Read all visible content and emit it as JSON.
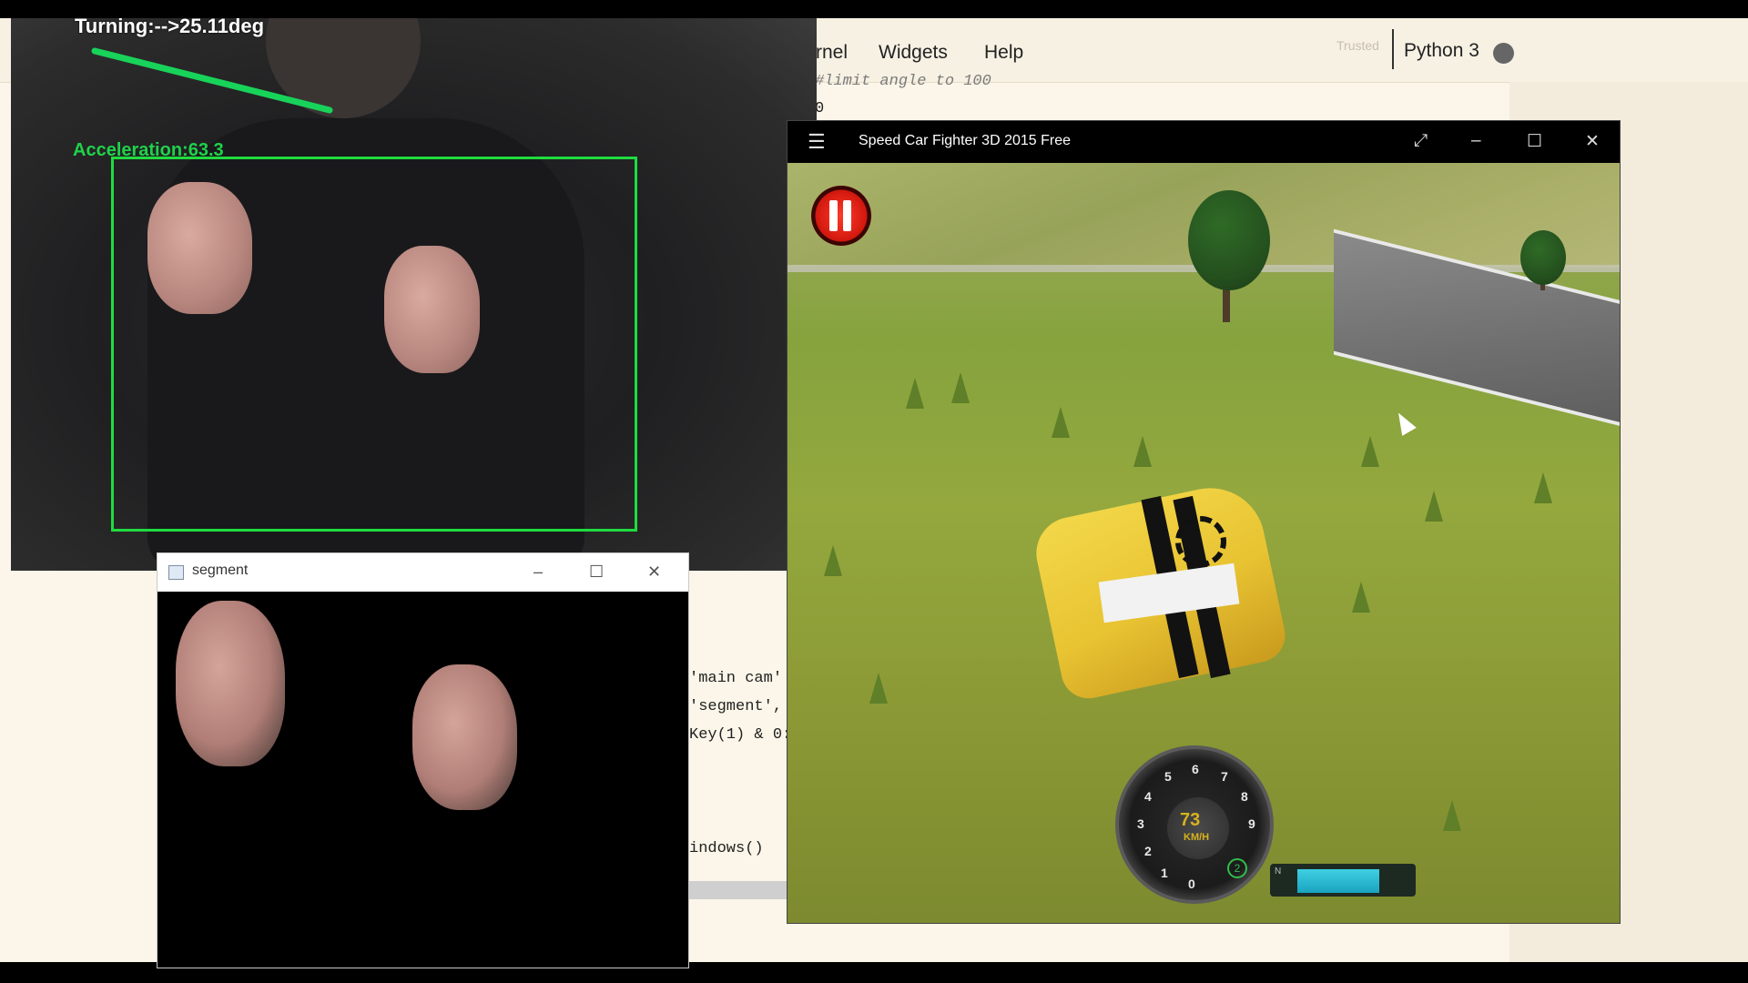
{
  "jupyter": {
    "menu": [
      "rnel",
      "Widgets",
      "Help"
    ],
    "trusted": "Trusted",
    "kernel": "Python 3",
    "code_lines": [
      {
        "text": "#limit angle to 100",
        "comment": true
      },
      {
        "text": "0",
        "comment": false
      },
      {
        "text": "'main cam'",
        "comment": false
      },
      {
        "text": "'segment',",
        "comment": false
      },
      {
        "text": "Key(1) & 0:",
        "comment": false
      },
      {
        "text": "indows()",
        "comment": false
      }
    ]
  },
  "camera": {
    "turning_text": "Turning:-->25.11deg",
    "acceleration_text": "Acceleration:63.3"
  },
  "segment_window": {
    "title": "segment",
    "minimize": "–",
    "maximize": "☐",
    "close": "✕"
  },
  "game_window": {
    "title": "Speed Car Fighter 3D 2015 Free",
    "menu_icon": "☰",
    "expand": "⤢",
    "minimize": "–",
    "maximize": "☐",
    "close": "✕",
    "speed": "73",
    "speed_unit": "KM/H",
    "gear": "2",
    "gauge_numbers": [
      "0",
      "1",
      "2",
      "3",
      "4",
      "5",
      "6",
      "7",
      "8",
      "9"
    ],
    "nitro_label": "N",
    "nitro_level": 0.75
  },
  "icons": [
    "hamburger-icon",
    "expand-icon",
    "minimize-icon",
    "maximize-icon",
    "close-icon",
    "pause-icon",
    "window-icon",
    "cursor-icon"
  ]
}
